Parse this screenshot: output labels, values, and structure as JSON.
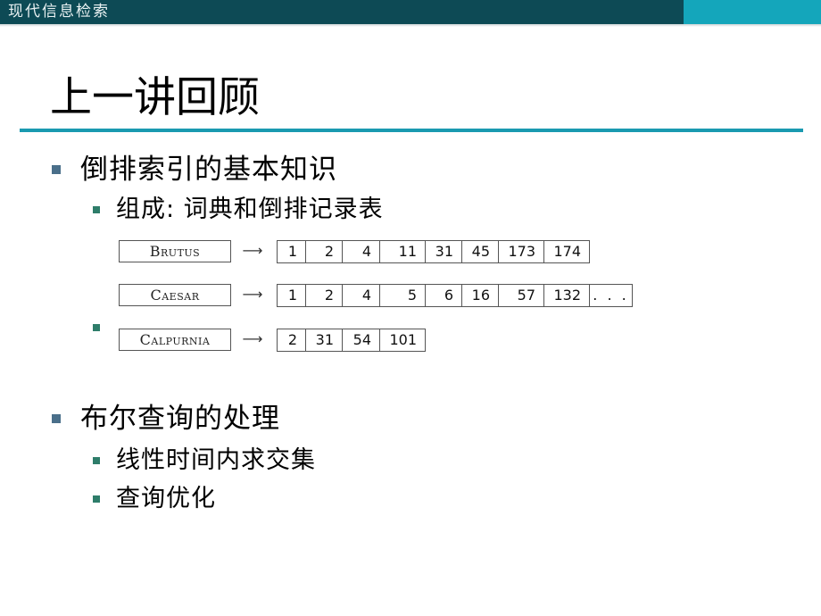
{
  "header": {
    "course_title": "现代信息检索"
  },
  "slide": {
    "title": "上一讲回顾",
    "bullets": [
      {
        "text": "倒排索引的基本知识",
        "children": [
          {
            "text": "组成: 词典和倒排记录表"
          },
          {
            "text": ""
          }
        ]
      },
      {
        "text": "布尔查询的处理",
        "children": [
          {
            "text": "线性时间内求交集"
          },
          {
            "text": "查询优化"
          }
        ]
      }
    ]
  },
  "index_figure": {
    "arrow": "⟶",
    "entries": [
      {
        "term": "Brutus",
        "postings": [
          "1",
          "2",
          "4",
          "11",
          "31",
          "45",
          "173",
          "174"
        ]
      },
      {
        "term": "Caesar",
        "postings": [
          "1",
          "2",
          "4",
          "5",
          "6",
          "16",
          "57",
          "132",
          "..."
        ]
      },
      {
        "term": "Calpurnia",
        "postings": [
          "2",
          "31",
          "54",
          "101"
        ]
      }
    ]
  },
  "colors": {
    "header_band": "#0d4a55",
    "header_accent": "#14a6bb",
    "title_rule": "#1a9ab0",
    "bullet_level1": "#4a6f8a",
    "bullet_level2": "#2e7d6a"
  }
}
